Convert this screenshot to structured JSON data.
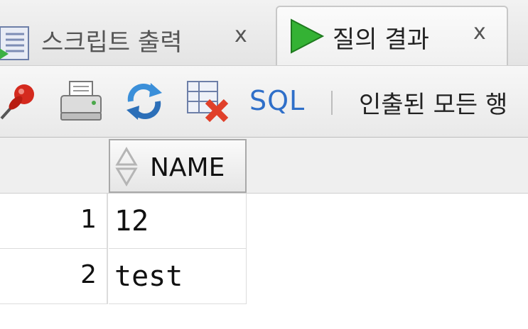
{
  "tabs": [
    {
      "label": "스크립트 출력",
      "close": "x",
      "icon": "document-run-icon"
    },
    {
      "label": "질의 결과",
      "close": "x",
      "icon": "play-icon",
      "active": true
    }
  ],
  "toolbar": {
    "sql_label": "SQL",
    "fetch_status": "인출된 모든 행"
  },
  "grid": {
    "columns": [
      {
        "name": "NAME"
      }
    ],
    "rows": [
      {
        "num": "1",
        "NAME": "12"
      },
      {
        "num": "2",
        "NAME": "test"
      }
    ]
  },
  "colors": {
    "accent": "#2f6fc9",
    "play": "#2fa82f",
    "delete": "#e0402a"
  }
}
